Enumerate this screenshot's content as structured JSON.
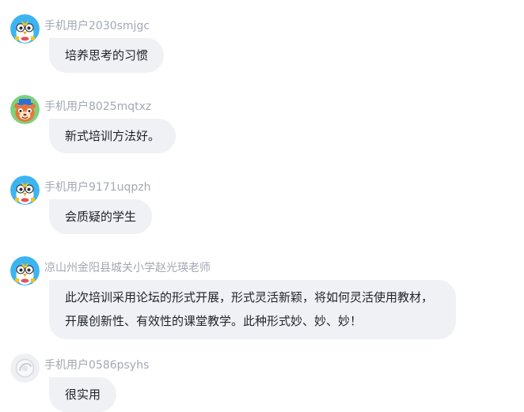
{
  "comments": [
    {
      "avatar": "owl-mascot-avatar",
      "name": "手机用户2030smjgc",
      "text": "培养思考的习惯"
    },
    {
      "avatar": "bear-mascot-avatar",
      "name": "手机用户8025mqtxz",
      "text": "新式培训方法好。"
    },
    {
      "avatar": "owl-mascot-avatar",
      "name": "手机用户9171uqpzh",
      "text": "会质疑的学生"
    },
    {
      "avatar": "owl-mascot-avatar",
      "name": "凉山州金阳县城关小学赵光瑛老师",
      "text": "此次培训采用论坛的形式开展，形式灵活新颖，将如何灵活使用教材，开展创新性、有效性的课堂教学。此种形式妙、妙、妙！"
    },
    {
      "avatar": "default-gray-avatar",
      "name": "手机用户0586psyhs",
      "text": "很实用"
    }
  ],
  "colors": {
    "bubble_bg": "#eff1f5",
    "username": "#a3a8b3",
    "text": "#1f2329",
    "avatar_blue": "#3db4f2"
  }
}
